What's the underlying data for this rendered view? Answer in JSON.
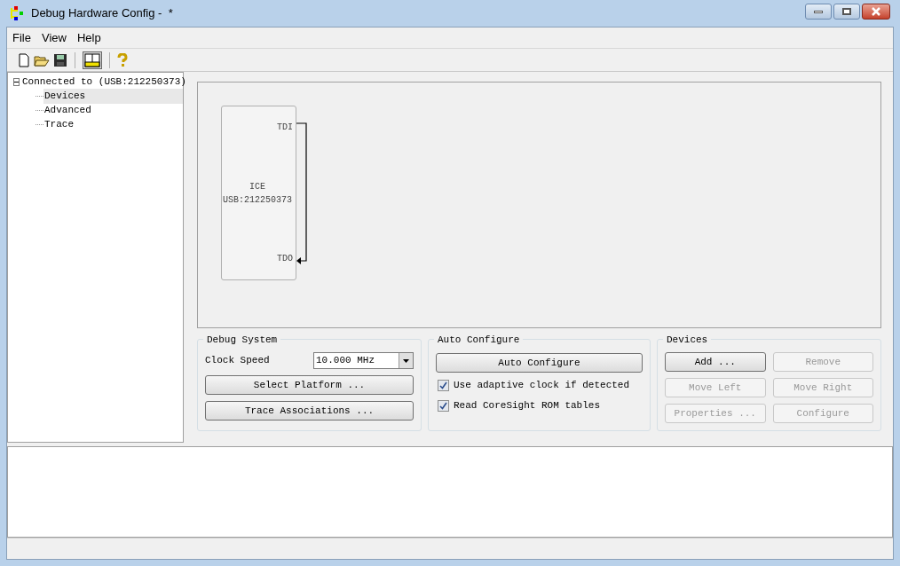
{
  "window": {
    "title": "Debug Hardware Config -  *"
  },
  "menu": [
    "File",
    "View",
    "Help"
  ],
  "tree": {
    "label": "Connected to (USB:212250373)",
    "expanded": true,
    "children": [
      {
        "label": "Devices",
        "selected": true
      },
      {
        "label": "Advanced",
        "selected": false
      },
      {
        "label": "Trace",
        "selected": false
      }
    ]
  },
  "diagram": {
    "device_name": "ICE",
    "device_id": "USB:212250373",
    "pin_in": "TDI",
    "pin_out": "TDO"
  },
  "debug_system": {
    "title": "Debug System",
    "clock_label": "Clock Speed",
    "clock_value": "10.000 MHz",
    "buttons": [
      "Select Platform ...",
      "Trace Associations ..."
    ]
  },
  "auto_configure": {
    "title": "Auto Configure",
    "button": "Auto Configure",
    "options": [
      {
        "label": "Use adaptive clock if detected",
        "checked": true
      },
      {
        "label": "Read CoreSight ROM tables",
        "checked": true
      }
    ]
  },
  "devices": {
    "title": "Devices",
    "buttons": [
      {
        "label": "Add ...",
        "disabled": false
      },
      {
        "label": "Remove",
        "disabled": true
      },
      {
        "label": "Move Left",
        "disabled": true
      },
      {
        "label": "Move Right",
        "disabled": true
      },
      {
        "label": "Properties ...",
        "disabled": true
      },
      {
        "label": "Configure",
        "disabled": true
      }
    ]
  }
}
